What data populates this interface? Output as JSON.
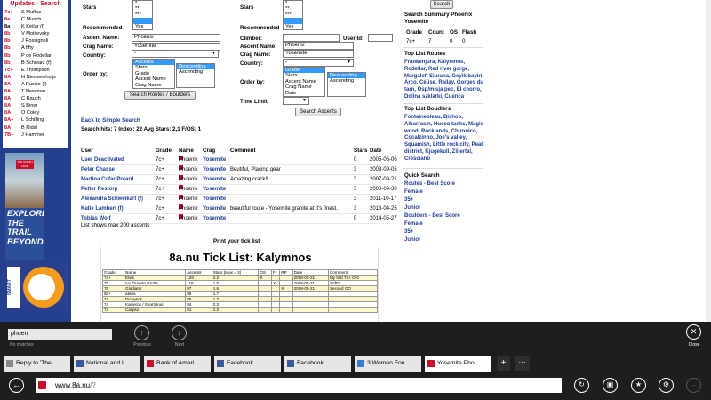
{
  "sidebar": {
    "updates_title": "Updates - Search",
    "updates": [
      {
        "grade": "7c+",
        "name": "S Muñoz",
        "red": true
      },
      {
        "grade": "8a",
        "name": "C Munch",
        "red": true
      },
      {
        "grade": "8a",
        "name": "K Kejlar (f)",
        "red": false
      },
      {
        "grade": "8b",
        "name": "V Motilevsky",
        "red": true
      },
      {
        "grade": "8b",
        "name": "J Rossignoli",
        "red": true
      },
      {
        "grade": "8b",
        "name": "A fifty",
        "red": true
      },
      {
        "grade": "8b",
        "name": "P de Rodellar",
        "red": true
      },
      {
        "grade": "8b",
        "name": "B Schwarz (f)",
        "red": true
      },
      {
        "grade": "7c+",
        "name": "E Thompson",
        "red": true
      },
      {
        "grade": "8A",
        "name": "H Nieuwenhuijs",
        "red": true
      },
      {
        "grade": "8A+",
        "name": "A Puccio (f)",
        "red": true
      },
      {
        "grade": "8A",
        "name": "T Newman",
        "red": true
      },
      {
        "grade": "8A",
        "name": "C Rauch",
        "red": true
      },
      {
        "grade": "8A",
        "name": "S Biner",
        "red": true
      },
      {
        "grade": "8A",
        "name": "O Coley",
        "red": true
      },
      {
        "grade": "8A+",
        "name": "L Schilling",
        "red": true
      },
      {
        "grade": "8A",
        "name": "B Ridal",
        "red": true
      },
      {
        "grade": "7B+",
        "name": "J Hammer",
        "red": true
      }
    ],
    "ad1_text": "EXPLORE THE TRAIL BEYOND",
    "ad1_logo": "THE NORTH FACE",
    "ad2_text": "SMART"
  },
  "form1": {
    "stars_label": "Stars",
    "stars_options": [
      "*",
      "**",
      "***",
      "",
      "Yes"
    ],
    "recommended_label": "Recommended",
    "ascent_label": "Ascent Name:",
    "ascent_value": "Phoenix",
    "crag_label": "Crag Name:",
    "crag_value": "Yosemite",
    "country_label": "Country:",
    "country_value": "-",
    "orderby_label": "Order by:",
    "order_options": [
      "Ascents",
      "Stars",
      "Grade",
      "Ascent Name",
      "Crag Name"
    ],
    "dir_options": [
      "Descending",
      "Ascending"
    ],
    "search_button": "Search Routes / Boulders"
  },
  "form2": {
    "stars_label": "Stars",
    "stars_options": [
      "*",
      "**",
      "***",
      "",
      "Yes"
    ],
    "recommended_label": "Recommended",
    "climber_label": "Climber:",
    "userid_label": "User Id:",
    "ascent_label": "Ascent Name:",
    "ascent_value": "Phoenix",
    "crag_label": "Crag Name:",
    "crag_value": "Yosemite",
    "country_label": "Country:",
    "country_value": "-",
    "orderby_label": "Order by:",
    "order_options": [
      "Grade",
      "Stars",
      "Ascent Name",
      "Crag Name",
      "Date"
    ],
    "dir_options": [
      "Descending",
      "Ascending"
    ],
    "timelimit_label": "Time Limit",
    "timelimit_value": "-",
    "search_button": "Search Ascents"
  },
  "results": {
    "back_link": "Back to Simple Search",
    "summary": "Search hits: 7 Index: 22 Avg Stars: 2,1 F/OS: 1",
    "headers": {
      "user": "User",
      "grade": "Grade",
      "name": "Name",
      "crag": "Crag",
      "comment": "Comment",
      "stars": "Stars",
      "date": "Date"
    },
    "rows": [
      {
        "user": "User Deactivated",
        "grade": "7c+",
        "name": "Phoenix",
        "crag": "Yosemite",
        "comment": "",
        "stars": "0",
        "date": "2005-06-06"
      },
      {
        "user": "Peter Chasse",
        "grade": "7c+",
        "name": "Phoenix",
        "crag": "Yosemite",
        "comment": "Beutiful, Placing gear",
        "stars": "3",
        "date": "2003-09-05"
      },
      {
        "user": "Martina Cufar Potard",
        "grade": "7c+",
        "name": "Phoenix",
        "crag": "Yosemite",
        "comment": "Amazing crack!!",
        "stars": "3",
        "date": "2007-09-21"
      },
      {
        "user": "Petter Restorp",
        "grade": "7c+",
        "name": "Phoenix",
        "crag": "Yosemite",
        "comment": "",
        "stars": "3",
        "date": "2008-09-30"
      },
      {
        "user": "Alexandra Schweikart (f)",
        "grade": "7c+",
        "name": "Phoenix",
        "crag": "Yosemite",
        "comment": "",
        "stars": "3",
        "date": "2011-10-17"
      },
      {
        "user": "Katie Lambert (f)",
        "grade": "7c+",
        "name": "Phoenix",
        "crag": "Yosemite",
        "comment": "beautiful route - Yosemite granite at it's finest.",
        "stars": "3",
        "date": "2013-04-25"
      },
      {
        "user": "Tobias Wolf",
        "grade": "7c+",
        "name": "Phoenix",
        "crag": "Yosemite",
        "comment": "",
        "stars": "0",
        "date": "2014-05-27"
      }
    ],
    "footer": "List shows max 200 ascents",
    "print_label": "Print your tick list"
  },
  "ticklist": {
    "title": "8a.nu Tick List: Kalymnos",
    "headers": [
      "Grade",
      "Name",
      "Ascents",
      "Stars (Max = 3)",
      "OS",
      "F",
      "RP",
      "Date",
      "Comment"
    ],
    "rows": [
      [
        "7a+",
        "Elvis",
        "126",
        "2.2",
        "X",
        "",
        "",
        "2008-05-21",
        "My first 7a+ OS!"
      ],
      [
        "7b",
        "Iv-i Grande Grotta",
        "116",
        "1.0",
        "",
        "X",
        "",
        "2008-05-21",
        "Soft?"
      ],
      [
        "7b",
        "Gladiator",
        "97",
        "1.6",
        "",
        "",
        "X",
        "2008-05-21",
        "Second GO"
      ],
      [
        "6b+",
        "ateria",
        "88",
        "1.7",
        "",
        "",
        "",
        "",
        ""
      ],
      [
        "7a",
        "Dionysos",
        "85",
        "1.7",
        "",
        "",
        "",
        "",
        ""
      ],
      [
        "7a",
        "Kaiveros / Spartakus",
        "84",
        "2.3",
        "",
        "",
        "",
        "",
        ""
      ],
      [
        "7a",
        "Calipso",
        "81",
        "1.2",
        "",
        "",
        "",
        "",
        ""
      ]
    ]
  },
  "right": {
    "search_button": "Search",
    "summary_title": "Search Summary Phoenix Yosemite",
    "summary_headers": [
      "Grade",
      "Count",
      "OS",
      "Flash"
    ],
    "summary_values": [
      "7c+",
      "7",
      "0",
      "0"
    ],
    "top_routes_title": "Top List Routes",
    "top_routes": "Frankenjura, Kalymnos, Rodellar, Red river gorge, Margalef, Siurana, Geyik bayiri, Arco, Céüse, Railay, Gorges du tarn, Osp/misja pec, El chorro, Dolina szklarki, Cuenca",
    "top_boulders_title": "Top List Boudlers",
    "top_boulders": "Fontainebleau, Bishop, Albarracín, Hueco tanks, Magic wood, Rocklands, Chironico, Cocalzinho, Joe's valley, Squamish, Little rock city, Peak district, Kjugekull, Zillertal, Cresciano",
    "quick_title": "Quick Search",
    "quick_items": [
      "Routes - Best Score",
      "Female",
      "35+",
      "Junior",
      "Boulders - Best Score",
      "Female",
      "35+",
      "Junior"
    ]
  },
  "findbar": {
    "query": "phoen",
    "status": "No matches",
    "previous": "Previous",
    "next": "Next",
    "close": "Close"
  },
  "tabs": [
    {
      "label": "Reply to 'The...",
      "icon": "page-icon",
      "color": "#888"
    },
    {
      "label": "National and L...",
      "icon": "news-icon",
      "color": "#3a5a9a"
    },
    {
      "label": "Bank of Ameri...",
      "icon": "bank-icon",
      "color": "#c8102e"
    },
    {
      "label": "Facebook",
      "icon": "facebook-icon",
      "color": "#3b5998"
    },
    {
      "label": "Facebook",
      "icon": "facebook-icon",
      "color": "#3b5998"
    },
    {
      "label": "3 Women Fou...",
      "icon": "globe-icon",
      "color": "#3a7bd5"
    },
    {
      "label": "Yosemite Pho...",
      "icon": "8a-icon",
      "color": "#c8102e"
    }
  ],
  "address": {
    "domain": "www.8a.nu",
    "path": "/?"
  }
}
